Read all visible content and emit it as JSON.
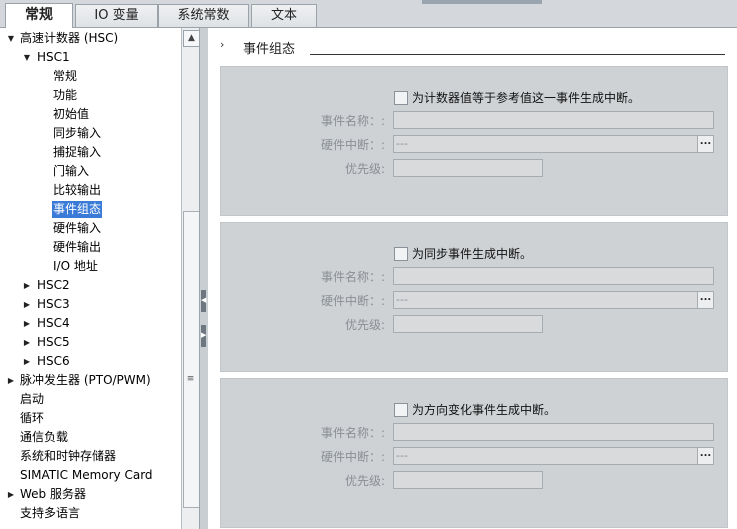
{
  "tabs": [
    {
      "label": "常规",
      "active": true
    },
    {
      "label": "IO 变量",
      "active": false
    },
    {
      "label": "系统常数",
      "active": false
    },
    {
      "label": "文本",
      "active": false
    }
  ],
  "tree": [
    {
      "label": "高速计数器 (HSC)",
      "arrow": "▼"
    },
    {
      "label": "HSC1",
      "arrow": "▼"
    },
    {
      "label": "常规",
      "arrow": ""
    },
    {
      "label": "功能",
      "arrow": ""
    },
    {
      "label": "初始值",
      "arrow": ""
    },
    {
      "label": "同步输入",
      "arrow": ""
    },
    {
      "label": "捕捉输入",
      "arrow": ""
    },
    {
      "label": "门输入",
      "arrow": ""
    },
    {
      "label": "比较输出",
      "arrow": ""
    },
    {
      "label": "事件组态",
      "arrow": "",
      "selected": true
    },
    {
      "label": "硬件输入",
      "arrow": ""
    },
    {
      "label": "硬件输出",
      "arrow": ""
    },
    {
      "label": "I/O 地址",
      "arrow": ""
    },
    {
      "label": "HSC2",
      "arrow": "▶"
    },
    {
      "label": "HSC3",
      "arrow": "▶"
    },
    {
      "label": "HSC4",
      "arrow": "▶"
    },
    {
      "label": "HSC5",
      "arrow": "▶"
    },
    {
      "label": "HSC6",
      "arrow": "▶"
    },
    {
      "label": "脉冲发生器 (PTO/PWM)",
      "arrow": "▶"
    },
    {
      "label": "启动",
      "arrow": ""
    },
    {
      "label": "循环",
      "arrow": ""
    },
    {
      "label": "通信负载",
      "arrow": ""
    },
    {
      "label": "系统和时钟存储器",
      "arrow": ""
    },
    {
      "label": "SIMATIC Memory Card",
      "arrow": ""
    },
    {
      "label": "Web 服务器",
      "arrow": "▶"
    },
    {
      "label": "支持多语言",
      "arrow": ""
    }
  ],
  "section": {
    "title": "事件组态",
    "chevron": "›"
  },
  "labels": {
    "event_name": "事件名称：:",
    "hw_interrupt": "硬件中断：:",
    "priority": "优先级:",
    "dropdown_value": "---",
    "dropdown_button": "..."
  },
  "groups": [
    {
      "checkbox_label": "为计数器值等于参考值这一事件生成中断。",
      "checked": false
    },
    {
      "checkbox_label": "为同步事件生成中断。",
      "checked": false
    },
    {
      "checkbox_label": "为方向变化事件生成中断。",
      "checked": false
    }
  ],
  "scroll": {
    "up_arrow": "▲",
    "grip": "≡"
  },
  "colors": {
    "selection": "#3b7bd8",
    "panel": "#cfd2d5",
    "tree_bg": "#ffffff"
  }
}
